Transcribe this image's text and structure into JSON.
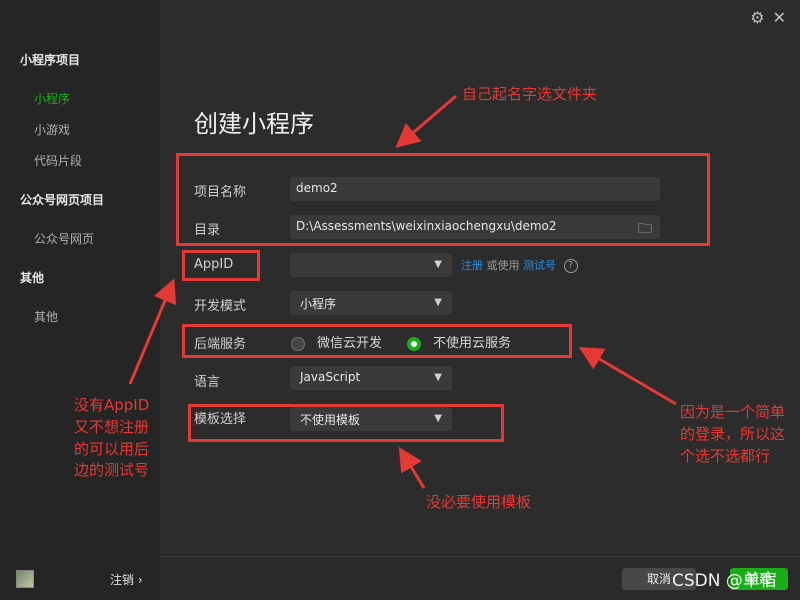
{
  "sidebar": {
    "groups": [
      "小程序项目",
      "公众号网页项目",
      "其他"
    ],
    "items": [
      {
        "label": "小程序",
        "active": true
      },
      {
        "label": "小游戏",
        "active": false
      },
      {
        "label": "代码片段",
        "active": false
      },
      {
        "label": "公众号网页",
        "active": false
      },
      {
        "label": "其他",
        "active": false
      }
    ],
    "logout_label": "注销 ›"
  },
  "top_icons": [
    "gear-icon",
    "close-icon"
  ],
  "form": {
    "title": "创建小程序",
    "project_name": {
      "label": "项目名称",
      "value": "demo2"
    },
    "directory": {
      "label": "目录",
      "value": "D:\\Assessments\\weixinxiaochengxu\\demo2"
    },
    "appid": {
      "label": "AppID",
      "value": "",
      "register_link": "注册",
      "or_use": "或使用",
      "test_link": "测试号",
      "help": "?"
    },
    "dev_mode": {
      "label": "开发模式",
      "value": "小程序"
    },
    "backend": {
      "label": "后端服务",
      "options": [
        "微信云开发",
        "不使用云服务"
      ],
      "selected": 1
    },
    "language": {
      "label": "语言",
      "value": "JavaScript"
    },
    "template": {
      "label": "模板选择",
      "value": "不使用模板"
    }
  },
  "footer": {
    "cancel_label": "取消",
    "ok_label": "新建",
    "watermark": "CSDN @单宿"
  },
  "annotations": {
    "folder_note": "自己起名字选文件夹",
    "appid_note": [
      "没有AppID",
      "又不想注册",
      "的可以用后",
      "边的测试号"
    ],
    "backend_note": [
      "因为是一个简单",
      "的登录，所以这",
      "个选不选都行"
    ],
    "template_note": "没必要使用模板"
  },
  "colors": {
    "accent": "#1aad19",
    "annotation_red": "#e53935",
    "link_blue": "#2a8fe0"
  }
}
